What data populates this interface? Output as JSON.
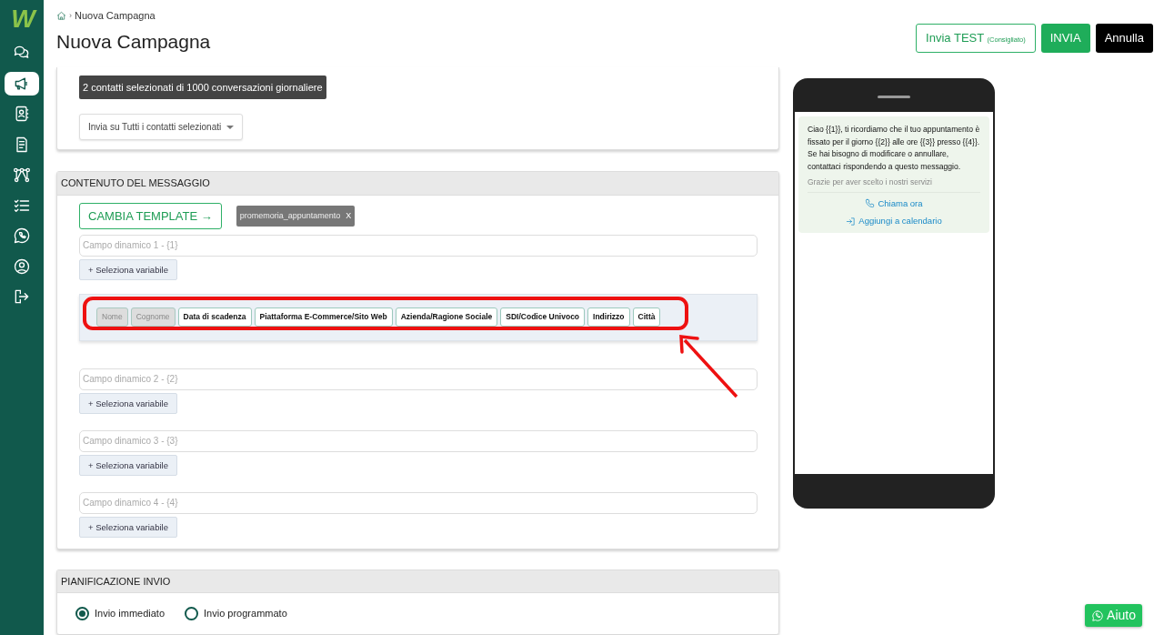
{
  "sidebar": {
    "logo": "W",
    "items": [
      {
        "selected": false
      },
      {
        "selected": true
      },
      {
        "selected": false
      },
      {
        "selected": false
      },
      {
        "selected": false
      },
      {
        "selected": false
      },
      {
        "selected": false
      },
      {
        "selected": false
      },
      {
        "selected": false
      }
    ]
  },
  "breadcrumb": {
    "separator": "›",
    "current": "Nuova Campagna"
  },
  "title": "Nuova Campagna",
  "actions": {
    "test": {
      "label": "Invia TEST",
      "note": "(Consigliato)"
    },
    "send": "INVIA",
    "cancel": "Annulla"
  },
  "recipients": {
    "badge": "2 contatti selezionati di 1000 conversazioni giornaliere",
    "dropdown": "Invia su Tutti i contatti selezionati"
  },
  "content": {
    "heading": "CONTENUTO DEL MESSAGGIO",
    "change_template": "CAMBIA TEMPLATE →",
    "template_tag": {
      "label": "promemoria_appuntamento",
      "remove": "X"
    },
    "fields": [
      {
        "placeholder": "Campo dinamico 1 - {1}",
        "select_button": "+ Seleziona variabile",
        "expanded": true,
        "variables": [
          {
            "label": "Nome",
            "disabled": true
          },
          {
            "label": "Cognome",
            "disabled": true
          },
          {
            "label": "Data di scadenza",
            "disabled": false
          },
          {
            "label": "Piattaforma E-Commerce/Sito Web",
            "disabled": false
          },
          {
            "label": "Azienda/Ragione Sociale",
            "disabled": false
          },
          {
            "label": "SDI/Codice Univoco",
            "disabled": false
          },
          {
            "label": "Indirizzo",
            "disabled": false
          },
          {
            "label": "Città",
            "disabled": false
          }
        ]
      },
      {
        "placeholder": "Campo dinamico 2 - {2}",
        "select_button": "+ Seleziona variabile",
        "expanded": false
      },
      {
        "placeholder": "Campo dinamico 3 - {3}",
        "select_button": "+ Seleziona variabile",
        "expanded": false
      },
      {
        "placeholder": "Campo dinamico 4 - {4}",
        "select_button": "+ Seleziona variabile",
        "expanded": false
      }
    ]
  },
  "schedule": {
    "heading": "PIANIFICAZIONE INVIO",
    "options": [
      {
        "label": "Invio immediato",
        "selected": true
      },
      {
        "label": "Invio programmato",
        "selected": false
      }
    ]
  },
  "preview": {
    "body": "Ciao {{1}}, ti ricordiamo che il tuo appuntamento è fissato per il giorno {{2}} alle ore {{3}} presso {{4}}.\nSe hai bisogno di modificare o annullare, contattaci rispondendo a questo messaggio.",
    "footer": "Grazie per aver scelto i nostri servizi",
    "buttons": [
      {
        "kind": "call",
        "label": "Chiama ora"
      },
      {
        "kind": "calendar",
        "label": "Aggiungi a calendario"
      }
    ]
  },
  "help_button": "Aiuto"
}
